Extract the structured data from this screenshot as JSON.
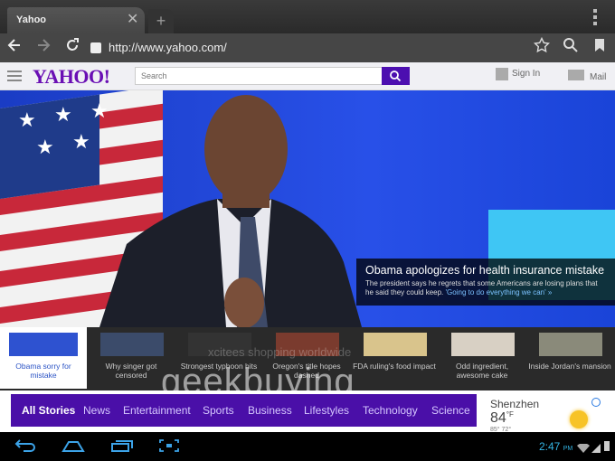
{
  "browser": {
    "tab_title": "Yahoo",
    "tab_close": "✕",
    "new_tab": "+",
    "url": "http://www.yahoo.com/"
  },
  "yahoo": {
    "logo": "YAHOO!",
    "search_placeholder": "Search",
    "signin": "Sign In",
    "mail": "Mail"
  },
  "hero": {
    "headline": "Obama apologizes for health insurance mistake",
    "summary": "The president says he regrets that some Americans are losing plans that he said they could keep.",
    "link": "'Going to do everything we can' »"
  },
  "watermark": {
    "brand": "geekbuying",
    "tagline": "xcitees shopping worldwide"
  },
  "stories": [
    {
      "label": "Obama sorry for mistake"
    },
    {
      "label": "Why singer got censored"
    },
    {
      "label": "Strongest typhoon hits"
    },
    {
      "label": "Oregon's title hopes dashed"
    },
    {
      "label": "FDA ruling's food impact"
    },
    {
      "label": "Odd ingredient, awesome cake"
    },
    {
      "label": "Inside Jordan's mansion"
    }
  ],
  "nav": [
    "All Stories",
    "News",
    "Entertainment",
    "Sports",
    "Business",
    "Lifestyles",
    "Technology",
    "Science"
  ],
  "weather": {
    "city": "Shenzhen",
    "temp": "84",
    "unit": "°F",
    "range": "85° 72°"
  },
  "status": {
    "time": "2:47",
    "ampm": "PM"
  },
  "colors": {
    "accent": "#4a0fa8",
    "logo": "#6a0fb4",
    "status": "#33b5e5"
  }
}
